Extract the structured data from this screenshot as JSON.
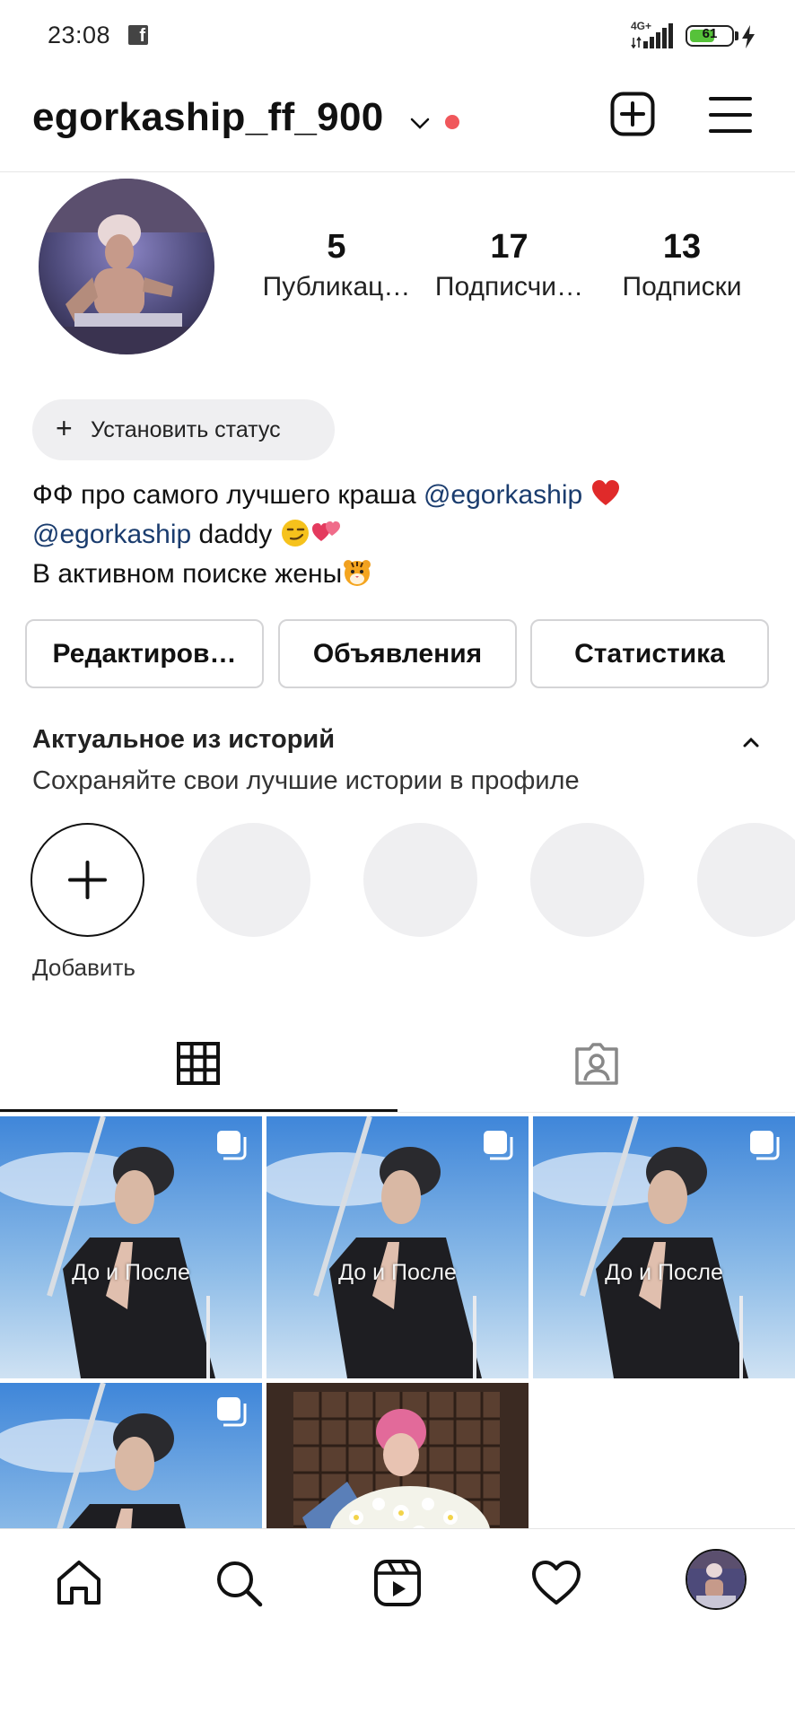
{
  "status_bar": {
    "time": "23:08",
    "notification_icon": "facebook-icon",
    "network": "4G+",
    "battery_level": "61",
    "battery_fraction": 0.61
  },
  "header": {
    "username": "egorkaship_ff_900",
    "icons": [
      "chevron-down-icon",
      "new-post-icon",
      "menu-icon"
    ]
  },
  "profile": {
    "stats": [
      {
        "value": "5",
        "label": "Публикац…"
      },
      {
        "value": "17",
        "label": "Подписчи…"
      },
      {
        "value": "13",
        "label": "Подписки"
      }
    ],
    "status_button": "Установить статус",
    "bio": {
      "line1_text": "ФФ про самого лучшего краша ",
      "line1_mention": "@egorkaship",
      "line2_mention": "@egorkaship",
      "line2_text": " daddy",
      "line3_text": "В активном поиске жены"
    }
  },
  "actions": {
    "edit": "Редактиров…",
    "ads": "Объявления",
    "stats": "Статистика"
  },
  "highlights": {
    "title": "Актуальное из историй",
    "subtitle": "Сохраняйте свои лучшие истории в профиле",
    "add_label": "Добавить"
  },
  "tabs": [
    "grid-icon",
    "tagged-icon"
  ],
  "posts": [
    {
      "caption": "До и После"
    },
    {
      "caption": "До и После"
    },
    {
      "caption": "До и После"
    },
    {
      "caption": ""
    },
    {
      "caption": ""
    }
  ],
  "bottom_nav": [
    "home-icon",
    "search-icon",
    "reels-icon",
    "heart-icon",
    "profile-avatar"
  ],
  "colors": {
    "accent_dot": "#f0575b",
    "mention": "#1a3c6e",
    "pill_bg": "#efeff1",
    "battery": "#56c23a"
  }
}
